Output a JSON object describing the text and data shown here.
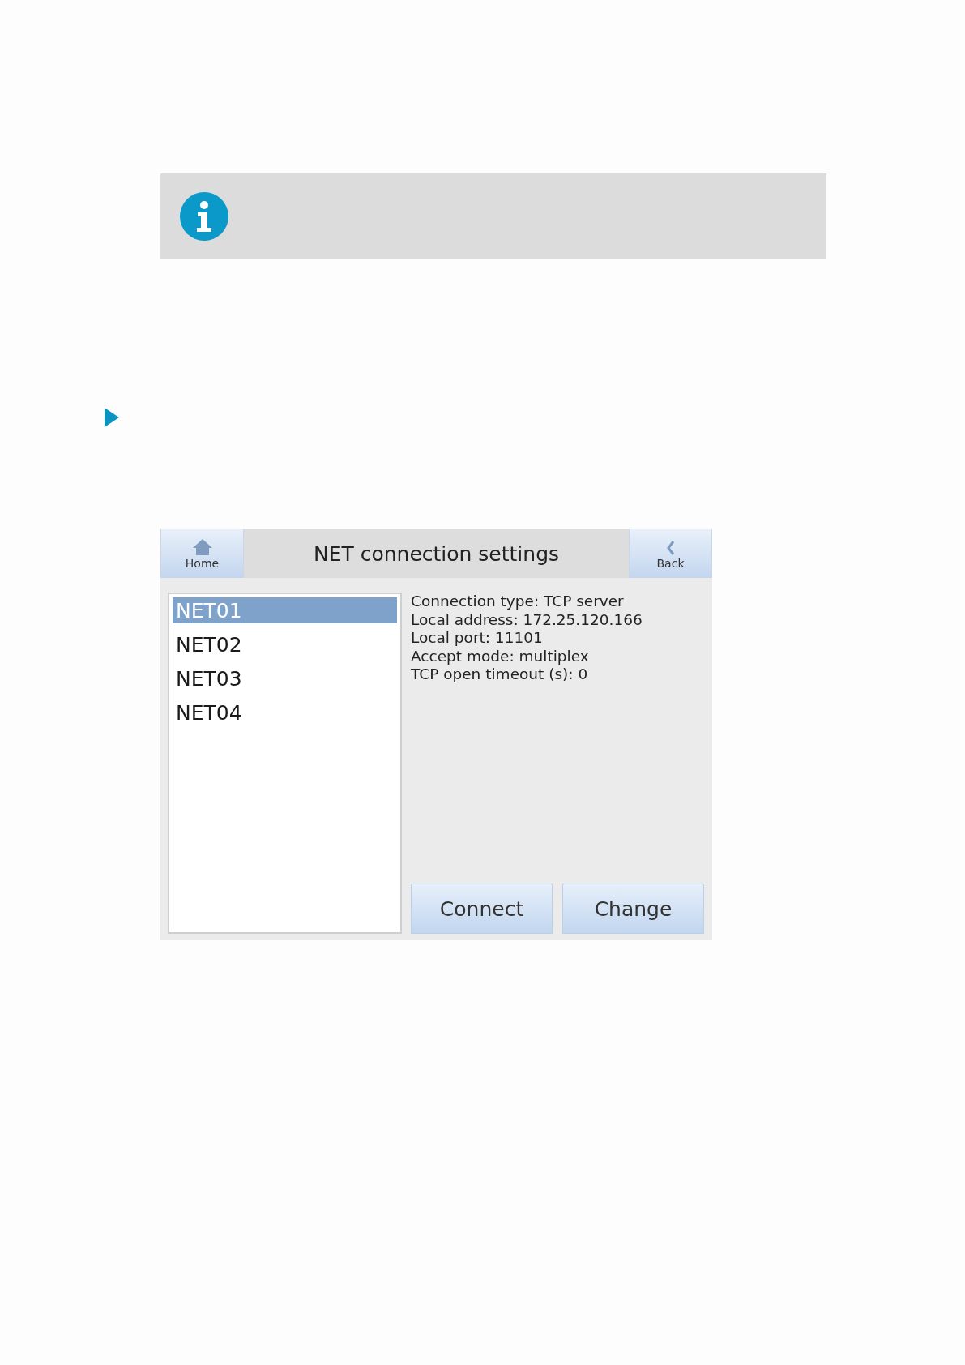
{
  "screen": {
    "title": "NET connection settings",
    "home_button": {
      "label": "Home"
    },
    "back_button": {
      "label": "Back"
    },
    "connections": [
      {
        "label": "NET01",
        "selected": true
      },
      {
        "label": "NET02",
        "selected": false
      },
      {
        "label": "NET03",
        "selected": false
      },
      {
        "label": "NET04",
        "selected": false
      }
    ],
    "details": [
      "Connection type: TCP server",
      "Local address: 172.25.120.166",
      "Local port: 11101",
      "Accept mode: multiplex",
      "TCP open timeout (s): 0"
    ],
    "buttons": [
      "Connect",
      "Change"
    ]
  }
}
